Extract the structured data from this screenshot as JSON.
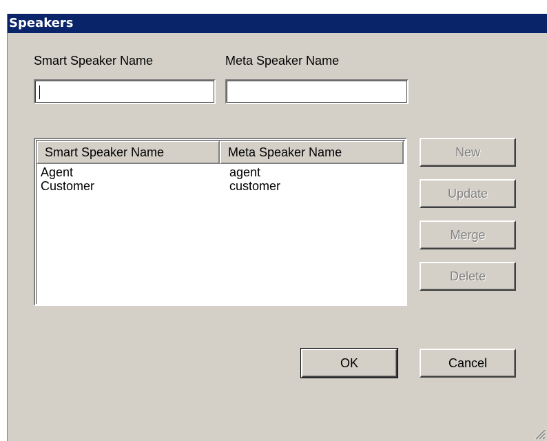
{
  "window": {
    "title": "Speakers"
  },
  "form": {
    "smart_label": "Smart Speaker Name",
    "meta_label": "Meta Speaker Name",
    "smart_value": "",
    "meta_value": ""
  },
  "list": {
    "columns": [
      "Smart Speaker Name",
      "Meta Speaker Name"
    ],
    "rows": [
      [
        "Agent",
        "agent"
      ],
      [
        "Customer",
        "customer"
      ]
    ]
  },
  "buttons": {
    "new": "New",
    "update": "Update",
    "merge": "Merge",
    "delete": "Delete",
    "ok": "OK",
    "cancel": "Cancel"
  },
  "colors": {
    "titlebar": "#0a246a",
    "face": "#d4d0c8",
    "disabled_text": "#808080"
  }
}
